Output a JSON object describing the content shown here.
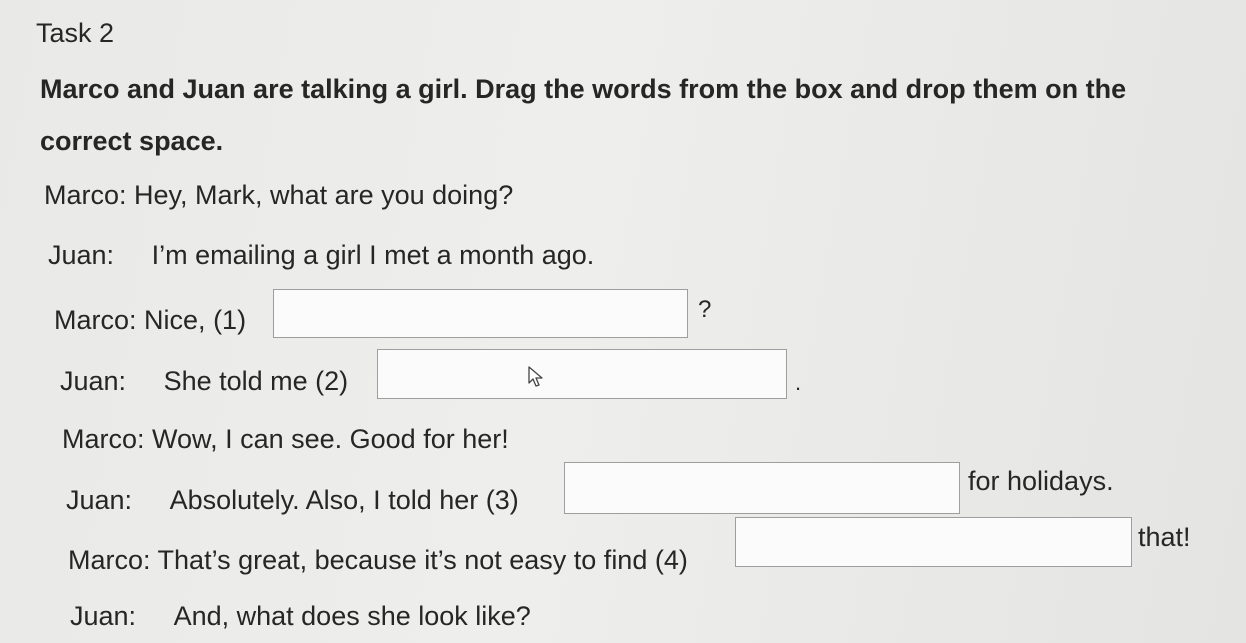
{
  "task": {
    "title": "Task 2",
    "instruction_line1": "Marco and Juan are talking a girl. Drag the words from the box and drop them on the",
    "instruction_line2": "correct space."
  },
  "dialogue": [
    {
      "speaker": "Marco:",
      "text": "Hey, Mark, what are you doing?"
    },
    {
      "speaker": "Juan:",
      "text": "I’m emailing a girl I met a month ago."
    },
    {
      "speaker": "Marco:",
      "before": "Nice, (1)",
      "after": "?"
    },
    {
      "speaker": "Juan:",
      "before": "She told me (2)",
      "after": "."
    },
    {
      "speaker": "Marco:",
      "text": "Wow, I can see. Good for her!"
    },
    {
      "speaker": "Juan:",
      "before": "Absolutely. Also, I told her (3)",
      "after": "for holidays."
    },
    {
      "speaker": "Marco:",
      "before": "That’s great, because it’s not easy to find (4)",
      "after": "that!"
    },
    {
      "speaker": "Juan:",
      "text": "And, what does she look like?"
    }
  ]
}
